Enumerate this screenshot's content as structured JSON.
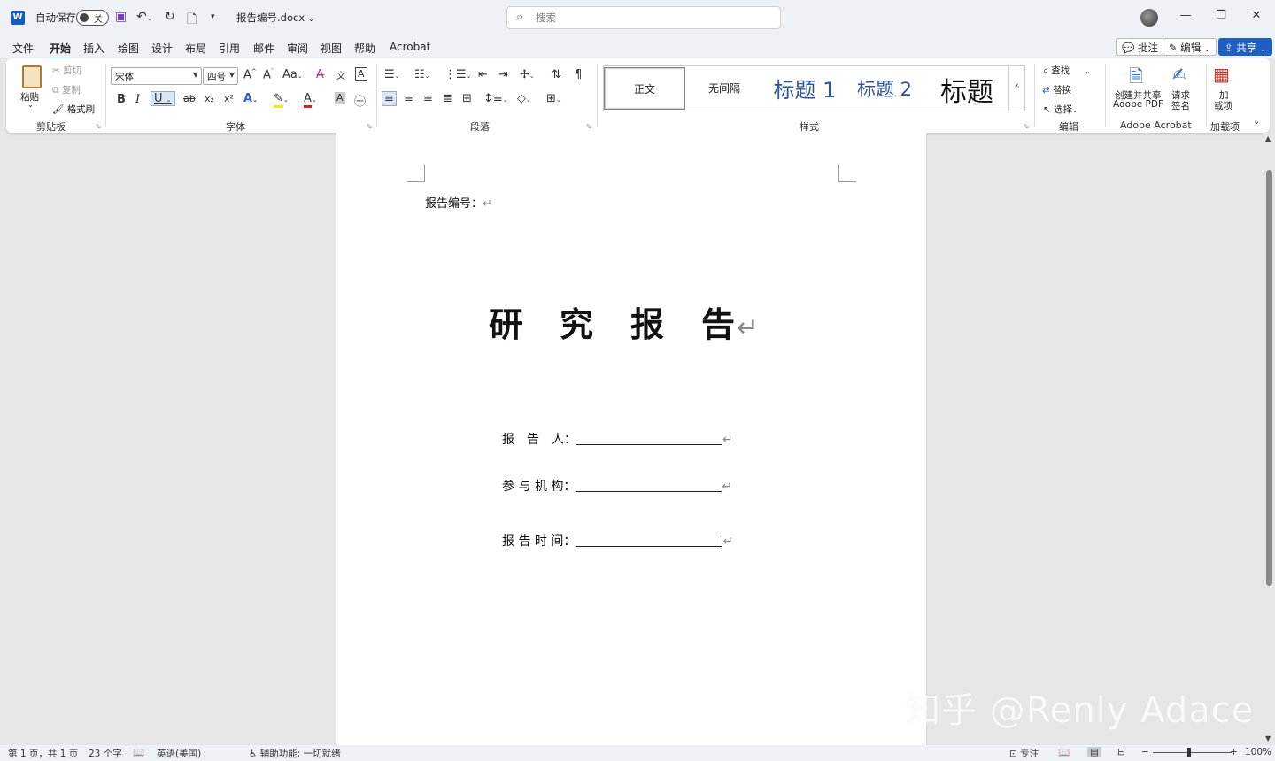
{
  "titlebar": {
    "autosave_label": "自动保存",
    "autosave_state": "关",
    "filename": "报告编号.docx",
    "search_placeholder": "搜索"
  },
  "menu": {
    "tabs": [
      "文件",
      "开始",
      "插入",
      "绘图",
      "设计",
      "布局",
      "引用",
      "邮件",
      "审阅",
      "视图",
      "帮助",
      "Acrobat"
    ],
    "active": "开始",
    "comments_label": "批注",
    "edit_label": "编辑",
    "share_label": "共享"
  },
  "ribbon": {
    "clipboard": {
      "paste": "粘贴",
      "cut": "剪切",
      "copy": "复制",
      "format_painter": "格式刷",
      "label": "剪贴板"
    },
    "font": {
      "name": "宋体",
      "size": "四号",
      "label": "字体"
    },
    "paragraph": {
      "label": "段落"
    },
    "styles": {
      "items": [
        "正文",
        "无间隔",
        "标题 1",
        "标题 2",
        "标题"
      ],
      "label": "样式"
    },
    "editing": {
      "find": "查找",
      "replace": "替换",
      "select": "选择",
      "label": "编辑"
    },
    "acrobat": {
      "create_share": "创建并共享",
      "adobe_pdf": "Adobe PDF",
      "request": "请求",
      "sign": "签名",
      "label": "Adobe Acrobat"
    },
    "addins": {
      "add1": "加",
      "add2": "载项",
      "label": "加载项"
    }
  },
  "document": {
    "report_no": "报告编号：",
    "title": "研　究　报　告",
    "fields": [
      {
        "label": "报　告　人："
      },
      {
        "label": "参 与 机 构："
      },
      {
        "label": "报 告 时 间："
      }
    ]
  },
  "statusbar": {
    "page": "第 1 页，共 1 页",
    "words": "23 个字",
    "language": "英语(美国)",
    "accessibility": "辅助功能: 一切就绪",
    "focus": "专注",
    "zoom": "100%"
  },
  "watermark": "知乎 @Renly Adace"
}
